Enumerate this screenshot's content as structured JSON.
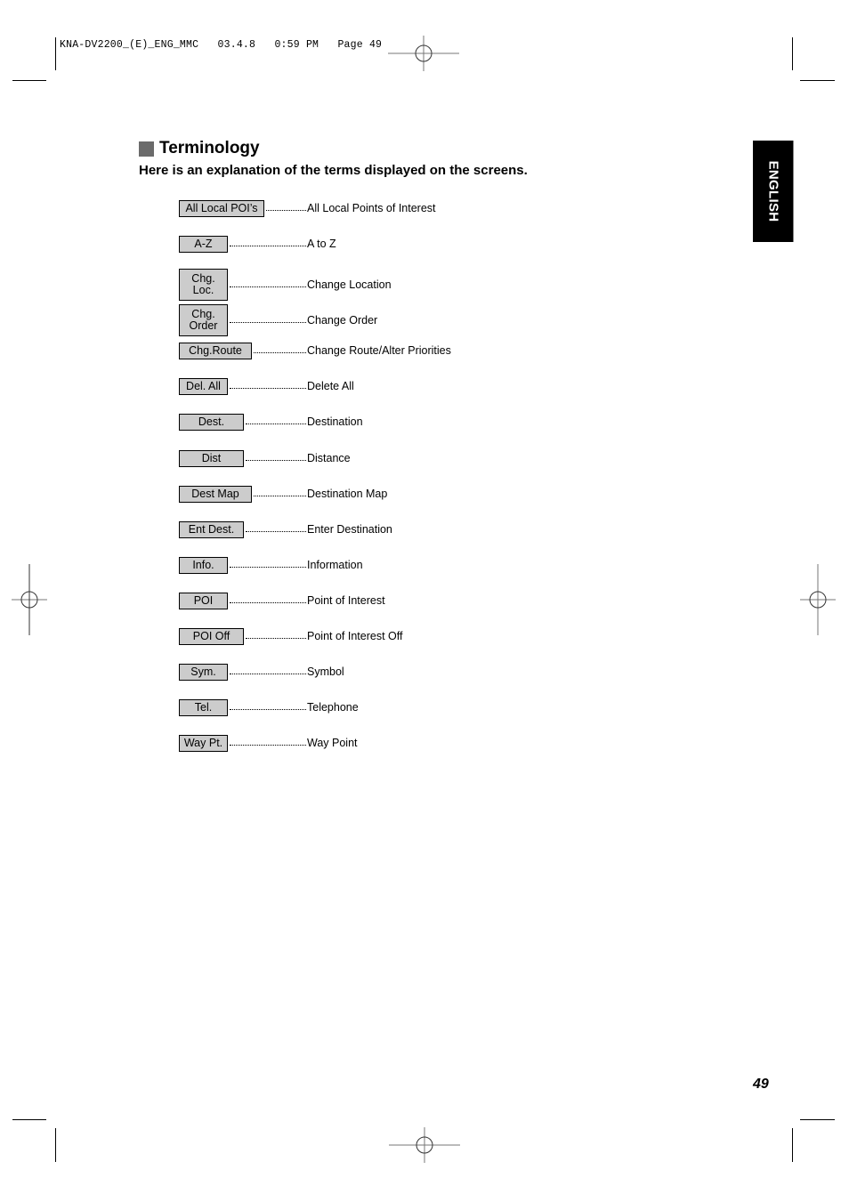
{
  "header": {
    "slug": "KNA-DV2200_(E)_ENG_MMC   03.4.8   0:59 PM   Page 49"
  },
  "section": {
    "title": "Terminology",
    "subtitle": "Here is an explanation of the terms displayed on the screens."
  },
  "language_tab": "ENGLISH",
  "terms": [
    {
      "key": "All Local POI’s",
      "definition": "All Local Points of Interest"
    },
    {
      "key": "A-Z",
      "definition": "A to Z"
    },
    {
      "key": "Chg. Loc.",
      "key_lines": [
        "Chg.",
        "Loc."
      ],
      "definition": "Change Location"
    },
    {
      "key": "Chg. Order",
      "key_lines": [
        "Chg.",
        "Order"
      ],
      "definition": "Change Order"
    },
    {
      "key": "Chg.Route",
      "definition": "Change Route/Alter Priorities"
    },
    {
      "key": "Del. All",
      "definition": "Delete All"
    },
    {
      "key": "Dest.",
      "definition": "Destination"
    },
    {
      "key": "Dist",
      "definition": "Distance"
    },
    {
      "key": "Dest Map",
      "definition": "Destination Map"
    },
    {
      "key": "Ent Dest.",
      "definition": "Enter Destination"
    },
    {
      "key": "Info.",
      "definition": "Information"
    },
    {
      "key": "POI",
      "definition": "Point of Interest"
    },
    {
      "key": "POI Off",
      "definition": "Point of Interest Off"
    },
    {
      "key": "Sym.",
      "definition": "Symbol"
    },
    {
      "key": "Tel.",
      "definition": "Telephone"
    },
    {
      "key": "Way Pt.",
      "definition": "Way Point"
    }
  ],
  "page_number": "49"
}
